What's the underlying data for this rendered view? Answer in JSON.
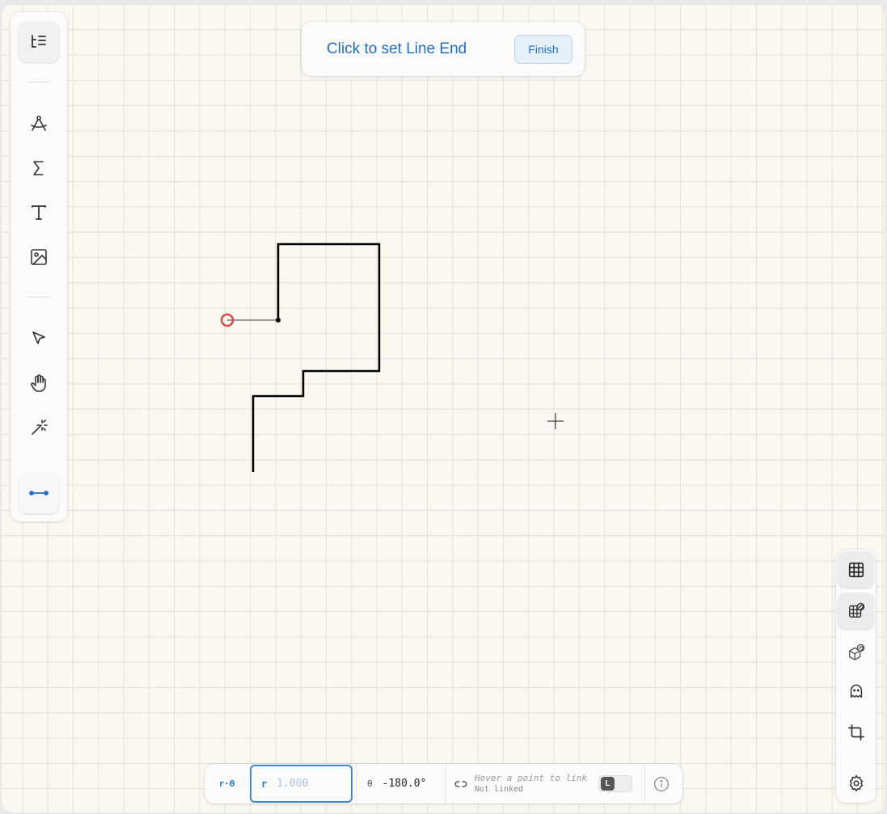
{
  "prompt": {
    "instruction": "Click to set Line End",
    "finish_label": "Finish"
  },
  "left_toolbar": {
    "tools": [
      {
        "name": "outline-panel",
        "icon": "list-tree-icon",
        "active": true
      },
      {
        "name": "geometry",
        "icon": "compass-icon"
      },
      {
        "name": "formula",
        "icon": "sigma-icon"
      },
      {
        "name": "text",
        "icon": "text-icon"
      },
      {
        "name": "image",
        "icon": "image-icon"
      },
      {
        "name": "select",
        "icon": "cursor-arrow-icon"
      },
      {
        "name": "pan",
        "icon": "hand-icon"
      },
      {
        "name": "magic",
        "icon": "magic-wand-icon"
      },
      {
        "name": "line-tool",
        "icon": "line-segment-icon",
        "active": true
      }
    ]
  },
  "right_toolbar": {
    "tools": [
      {
        "name": "grid",
        "icon": "grid-icon",
        "active": true
      },
      {
        "name": "snap-to-grid",
        "icon": "grid-magnet-icon",
        "active": true
      },
      {
        "name": "snap-to-objects",
        "icon": "cube-magnet-icon"
      },
      {
        "name": "ghost",
        "icon": "ghost-icon"
      },
      {
        "name": "crop",
        "icon": "crop-icon"
      },
      {
        "name": "settings",
        "icon": "gear-icon"
      }
    ]
  },
  "bottom_bar": {
    "mode_label": "r·θ",
    "r_label": "r",
    "r_placeholder": "1.000",
    "theta_label": "θ",
    "theta_value": "-180.0°",
    "link_hint": "Hover a point to link",
    "link_status": "Not linked",
    "link_key": "L"
  },
  "colors": {
    "accent": "#1e6fd0",
    "canvas_background": "#faf8f1",
    "grid_line": "#e3e1d8",
    "stroke": "#000000",
    "preview_endpoint": "#e04848"
  }
}
